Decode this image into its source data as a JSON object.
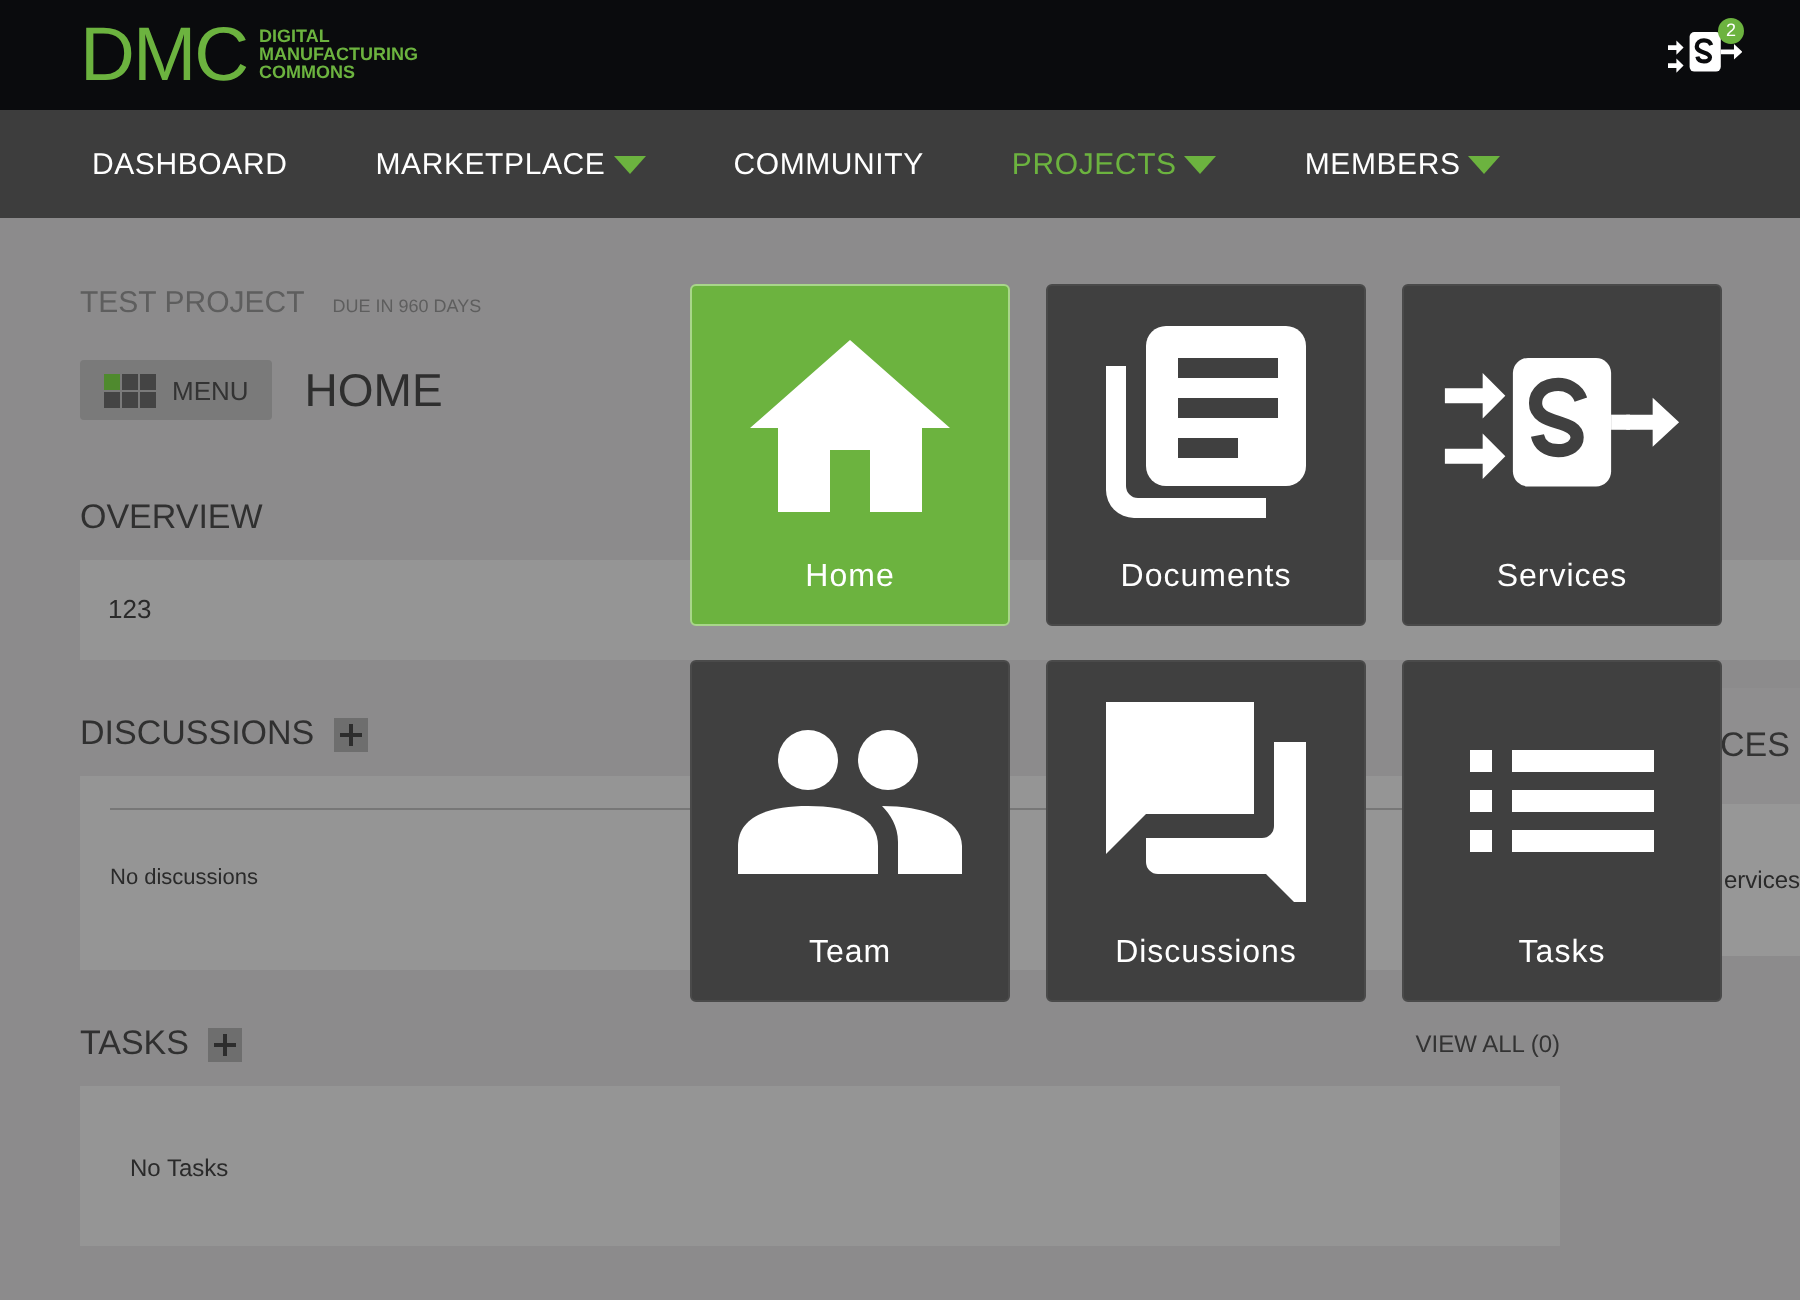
{
  "brand": {
    "logo": "DMC",
    "tagline": [
      "DIGITAL",
      "MANUFACTURING",
      "COMMONS"
    ]
  },
  "header": {
    "services_badge": "2"
  },
  "nav": [
    {
      "label": "DASHBOARD",
      "selected": false,
      "dropdown": false
    },
    {
      "label": "MARKETPLACE",
      "selected": false,
      "dropdown": true
    },
    {
      "label": "COMMUNITY",
      "selected": false,
      "dropdown": false
    },
    {
      "label": "PROJECTS",
      "selected": true,
      "dropdown": true
    },
    {
      "label": "MEMBERS",
      "selected": false,
      "dropdown": true
    }
  ],
  "project": {
    "title": "TEST PROJECT",
    "due": "DUE IN 960 DAYS",
    "menu_button": "MENU",
    "page_title": "HOME"
  },
  "sections": [
    {
      "kind": "overview",
      "title": "OVERVIEW",
      "add": false,
      "body": "123"
    },
    {
      "kind": "discussions",
      "title": "DISCUSSIONS",
      "add": true,
      "body": "No discussions"
    },
    {
      "kind": "tasks",
      "title": "TASKS",
      "add": true,
      "body": "No Tasks",
      "view_all": "VIEW ALL (0)"
    }
  ],
  "right_panel": {
    "title": "CES",
    "text": "ervices"
  },
  "tiles": [
    {
      "label": "Home",
      "kind": "home",
      "selected": true
    },
    {
      "label": "Documents",
      "kind": "documents",
      "selected": false
    },
    {
      "label": "Services",
      "kind": "services",
      "selected": false
    },
    {
      "label": "Team",
      "kind": "team",
      "selected": false
    },
    {
      "label": "Discussions",
      "kind": "discussions",
      "selected": false
    },
    {
      "label": "Tasks",
      "kind": "tasks",
      "selected": false
    }
  ]
}
